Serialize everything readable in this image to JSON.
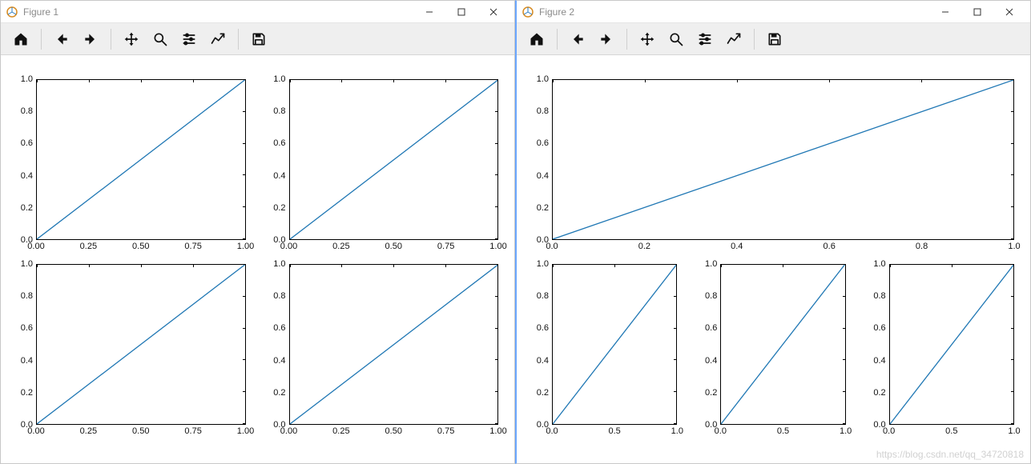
{
  "windows": [
    {
      "title": "Figure 1"
    },
    {
      "title": "Figure 2"
    }
  ],
  "toolbar": {
    "home": "Home",
    "back": "Back",
    "forward": "Forward",
    "pan": "Pan",
    "zoom": "Zoom",
    "subplots": "Configure subplots",
    "customize": "Edit axis",
    "save": "Save"
  },
  "watermark": "https://blog.csdn.net/qq_34720818",
  "chart_data": [
    {
      "figure": "Figure 1",
      "layout": "2x2",
      "subplots": [
        {
          "type": "line",
          "x": [
            0.0,
            1.0
          ],
          "y": [
            0.0,
            1.0
          ],
          "xticks": [
            "0.00",
            "0.25",
            "0.50",
            "0.75",
            "1.00"
          ],
          "yticks": [
            "0.0",
            "0.2",
            "0.4",
            "0.6",
            "0.8",
            "1.0"
          ],
          "xlim": [
            0.0,
            1.0
          ],
          "ylim": [
            0.0,
            1.0
          ]
        },
        {
          "type": "line",
          "x": [
            0.0,
            1.0
          ],
          "y": [
            0.0,
            1.0
          ],
          "xticks": [
            "0.00",
            "0.25",
            "0.50",
            "0.75",
            "1.00"
          ],
          "yticks": [
            "0.0",
            "0.2",
            "0.4",
            "0.6",
            "0.8",
            "1.0"
          ],
          "xlim": [
            0.0,
            1.0
          ],
          "ylim": [
            0.0,
            1.0
          ]
        },
        {
          "type": "line",
          "x": [
            0.0,
            1.0
          ],
          "y": [
            0.0,
            1.0
          ],
          "xticks": [
            "0.00",
            "0.25",
            "0.50",
            "0.75",
            "1.00"
          ],
          "yticks": [
            "0.0",
            "0.2",
            "0.4",
            "0.6",
            "0.8",
            "1.0"
          ],
          "xlim": [
            0.0,
            1.0
          ],
          "ylim": [
            0.0,
            1.0
          ]
        },
        {
          "type": "line",
          "x": [
            0.0,
            1.0
          ],
          "y": [
            0.0,
            1.0
          ],
          "xticks": [
            "0.00",
            "0.25",
            "0.50",
            "0.75",
            "1.00"
          ],
          "yticks": [
            "0.0",
            "0.2",
            "0.4",
            "0.6",
            "0.8",
            "1.0"
          ],
          "xlim": [
            0.0,
            1.0
          ],
          "ylim": [
            0.0,
            1.0
          ]
        }
      ]
    },
    {
      "figure": "Figure 2",
      "layout": "2x3 (top row spans 3)",
      "subplots": [
        {
          "type": "line",
          "colspan": 3,
          "x": [
            0.0,
            1.0
          ],
          "y": [
            0.0,
            1.0
          ],
          "xticks": [
            "0.0",
            "0.2",
            "0.4",
            "0.6",
            "0.8",
            "1.0"
          ],
          "yticks": [
            "0.0",
            "0.2",
            "0.4",
            "0.6",
            "0.8",
            "1.0"
          ],
          "xlim": [
            0.0,
            1.0
          ],
          "ylim": [
            0.0,
            1.0
          ]
        },
        {
          "type": "line",
          "x": [
            0.0,
            1.0
          ],
          "y": [
            0.0,
            1.0
          ],
          "xticks": [
            "0.0",
            "0.5",
            "1.0"
          ],
          "yticks": [
            "0.0",
            "0.2",
            "0.4",
            "0.6",
            "0.8",
            "1.0"
          ],
          "xlim": [
            0.0,
            1.0
          ],
          "ylim": [
            0.0,
            1.0
          ]
        },
        {
          "type": "line",
          "x": [
            0.0,
            1.0
          ],
          "y": [
            0.0,
            1.0
          ],
          "xticks": [
            "0.0",
            "0.5",
            "1.0"
          ],
          "yticks": [
            "0.0",
            "0.2",
            "0.4",
            "0.6",
            "0.8",
            "1.0"
          ],
          "xlim": [
            0.0,
            1.0
          ],
          "ylim": [
            0.0,
            1.0
          ]
        },
        {
          "type": "line",
          "x": [
            0.0,
            1.0
          ],
          "y": [
            0.0,
            1.0
          ],
          "xticks": [
            "0.0",
            "0.5",
            "1.0"
          ],
          "yticks": [
            "0.0",
            "0.2",
            "0.4",
            "0.6",
            "0.8",
            "1.0"
          ],
          "xlim": [
            0.0,
            1.0
          ],
          "ylim": [
            0.0,
            1.0
          ]
        }
      ]
    }
  ]
}
